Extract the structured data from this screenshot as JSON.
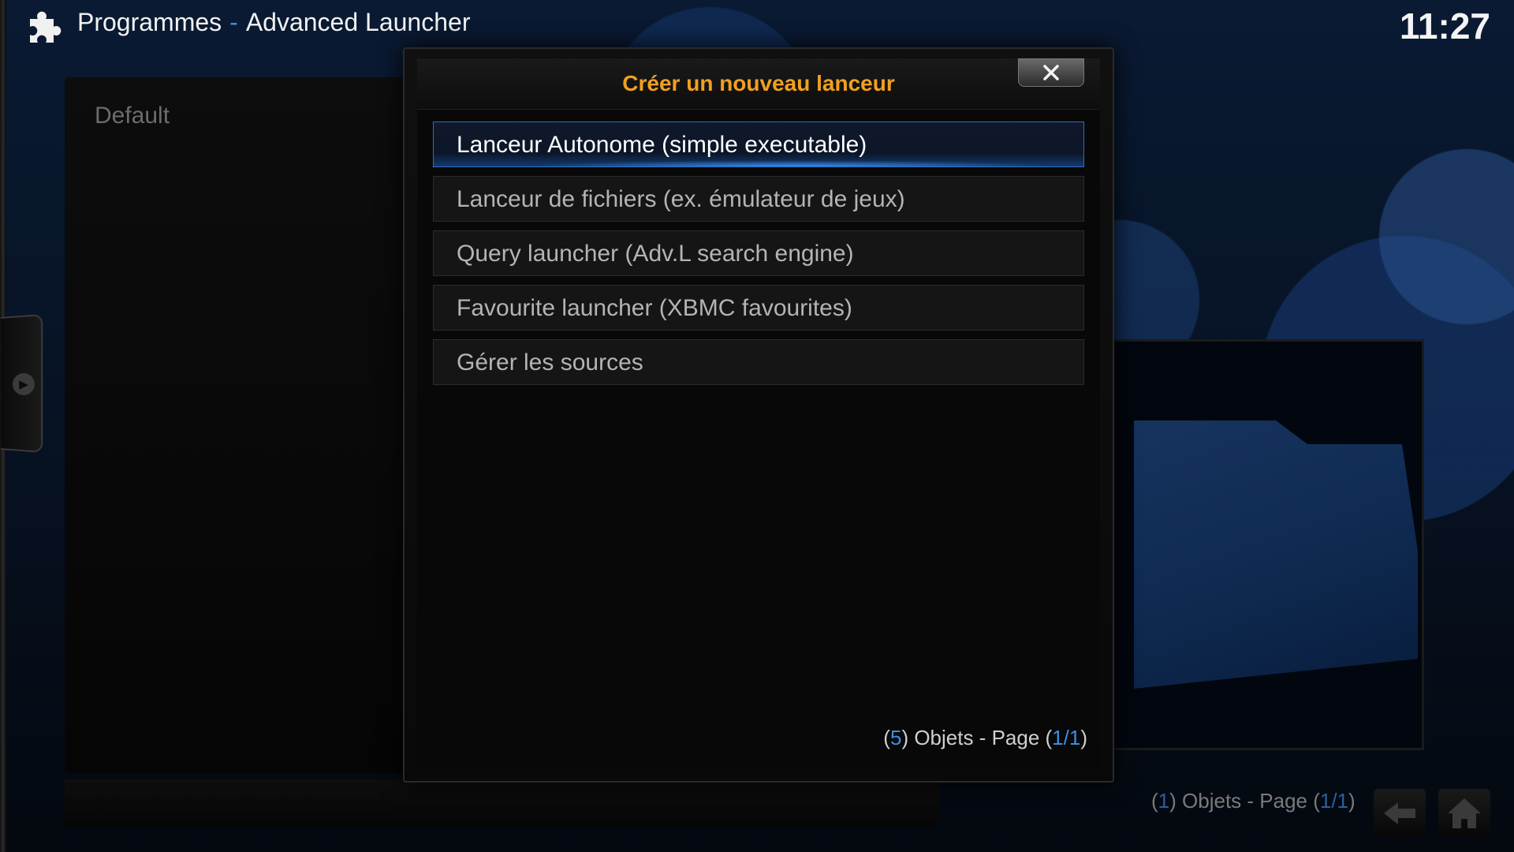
{
  "header": {
    "section": "Programmes",
    "separator": "-",
    "addon": "Advanced Launcher",
    "clock": "11:27"
  },
  "left_panel": {
    "label": "Default"
  },
  "dialog": {
    "title": "Créer un nouveau lanceur",
    "close_icon": "close-x-icon",
    "items": [
      {
        "label": "Lanceur Autonome (simple executable)",
        "focused": true
      },
      {
        "label": "Lanceur de fichiers (ex. émulateur de jeux)",
        "focused": false
      },
      {
        "label": "Query launcher (Adv.L search engine)",
        "focused": false
      },
      {
        "label": "Favourite launcher (XBMC favourites)",
        "focused": false
      },
      {
        "label": "Gérer les sources",
        "focused": false
      }
    ],
    "count": {
      "open": "(",
      "items": "5",
      "middle": ") Objets - Page (",
      "page": "1/1",
      "close": ")"
    }
  },
  "footer": {
    "count": {
      "open": "(",
      "items": "1",
      "middle": ") Objets - Page (",
      "page": "1/1",
      "close": ")"
    },
    "back_icon": "back-arrow-icon",
    "home_icon": "home-icon"
  },
  "colors": {
    "accent_blue": "#3a8ee6",
    "title_orange": "#f0a020"
  }
}
